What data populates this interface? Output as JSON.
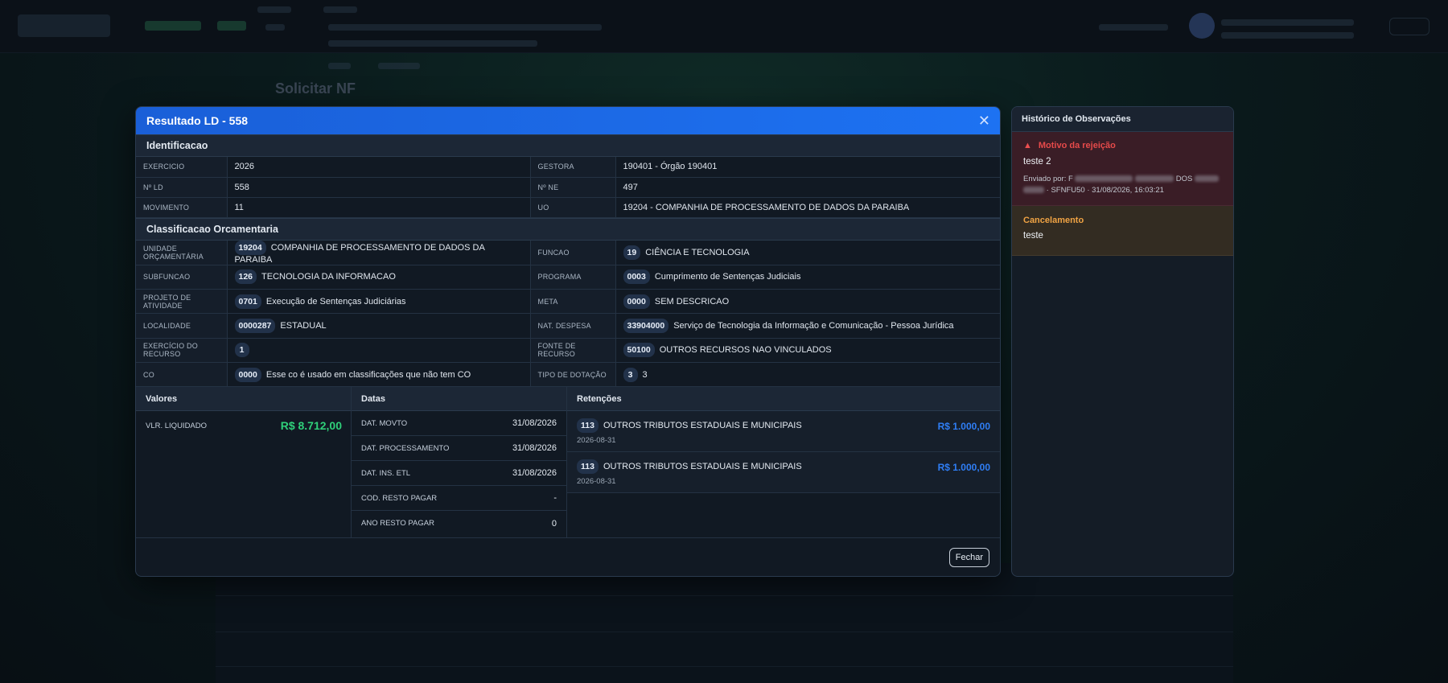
{
  "modal": {
    "title": "Resultado LD - 558",
    "close_label": "Fechar",
    "identificacao": {
      "title": "Identificacao",
      "rows": [
        {
          "l1": "EXERCICIO",
          "v1": "2026",
          "l2": "GESTORA",
          "v2": "190401 - Órgão 190401"
        },
        {
          "l1": "Nº LD",
          "v1": "558",
          "l2": "Nº NE",
          "v2": "497"
        },
        {
          "l1": "MOVIMENTO",
          "v1": "11",
          "l2": "UO",
          "v2": "19204 - COMPANHIA DE PROCESSAMENTO DE DADOS DA PARAIBA"
        }
      ]
    },
    "classificacao": {
      "title": "Classificacao Orcamentaria",
      "rows": [
        {
          "l1": "UNIDADE ORÇAMENTÁRIA",
          "c1": "19204",
          "t1": "COMPANHIA DE PROCESSAMENTO DE DADOS DA PARAIBA",
          "l2": "FUNCAO",
          "c2": "19",
          "t2": "CIÊNCIA E TECNOLOGIA"
        },
        {
          "l1": "SUBFUNCAO",
          "c1": "126",
          "t1": "TECNOLOGIA DA INFORMACAO",
          "l2": "PROGRAMA",
          "c2": "0003",
          "t2": "Cumprimento de Sentenças Judiciais"
        },
        {
          "l1": "PROJETO DE ATIVIDADE",
          "c1": "0701",
          "t1": "Execução de Sentenças Judiciárias",
          "l2": "META",
          "c2": "0000",
          "t2": "SEM DESCRICAO"
        },
        {
          "l1": "LOCALIDADE",
          "c1": "0000287",
          "t1": "ESTADUAL",
          "l2": "NAT. DESPESA",
          "c2": "33904000",
          "t2": "Serviço de Tecnologia da Informação e Comunicação - Pessoa Jurídica"
        },
        {
          "l1": "EXERCÍCIO DO RECURSO",
          "c1": "1",
          "t1": "",
          "l2": "FONTE DE RECURSO",
          "c2": "50100",
          "t2": "OUTROS RECURSOS NAO VINCULADOS"
        },
        {
          "l1": "CO",
          "c1": "0000",
          "t1": "Esse co é usado em classificações que não tem CO",
          "l2": "TIPO DE DOTAÇÃO",
          "c2": "3",
          "t2": "3"
        }
      ]
    },
    "valores": {
      "title": "Valores",
      "label": "VLR. LIQUIDADO",
      "amount": "R$ 8.712,00"
    },
    "datas": {
      "title": "Datas",
      "rows": [
        {
          "label": "DAT. MOVTO",
          "value": "31/08/2026"
        },
        {
          "label": "DAT. PROCESSAMENTO",
          "value": "31/08/2026"
        },
        {
          "label": "DAT. INS. ETL",
          "value": "31/08/2026"
        },
        {
          "label": "COD. RESTO PAGAR",
          "value": "-"
        },
        {
          "label": "ANO RESTO PAGAR",
          "value": "0"
        }
      ]
    },
    "retencoes": {
      "title": "Retenções",
      "items": [
        {
          "code": "113",
          "desc": "OUTROS TRIBUTOS ESTADUAIS E MUNICIPAIS",
          "amount": "R$ 1.000,00",
          "date": "2026-08-31"
        },
        {
          "code": "113",
          "desc": "OUTROS TRIBUTOS ESTADUAIS E MUNICIPAIS",
          "amount": "R$ 1.000,00",
          "date": "2026-08-31"
        }
      ]
    }
  },
  "historico": {
    "title": "Histórico de Observações",
    "rejeicao": {
      "title": "Motivo da rejeição",
      "text": "teste 2",
      "meta_prefix": "Enviado por: F",
      "meta_mid": "DOS",
      "meta_suffix": "· SFNFU50 · 31/08/2026, 16:03:21"
    },
    "cancelamento": {
      "title": "Cancelamento",
      "text": "teste"
    }
  },
  "background": {
    "page_title": "Solicitar NF"
  },
  "colors": {
    "header_blue": "#1d72f2",
    "money_green": "#2fd07a",
    "money_blue": "#2f7ef5",
    "reject_red": "#e64a4a",
    "cancel_orange": "#f0a344"
  },
  "icons": {
    "close": "close-icon",
    "warning": "warning-icon"
  }
}
